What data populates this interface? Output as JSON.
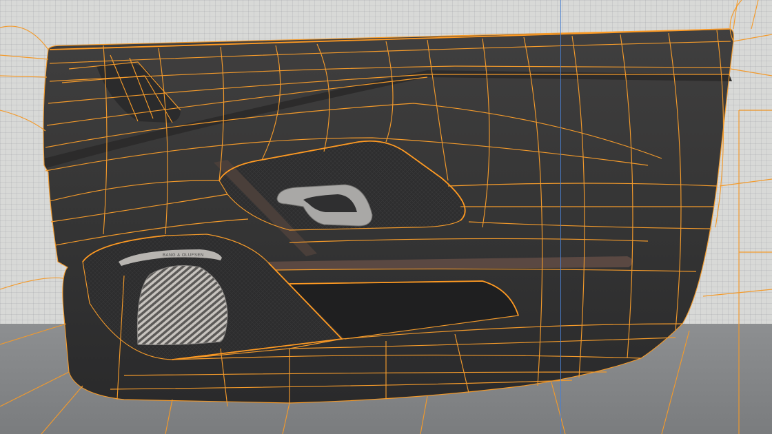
{
  "scene": {
    "object": "car-door-interior-panel",
    "overlay": "wireframe-topology",
    "colors": {
      "wireframe": "#f39a2b",
      "panel": "#3a3a3b",
      "panel_dark": "#262627",
      "background": "#d8d9d7",
      "floor": "#84868a",
      "axis": "#4a7fd0",
      "speaker": "#b5b1ac",
      "handle": "#a8a7a5"
    }
  },
  "speaker_grille": {
    "brand_text": "BANG & OLUFSEN"
  }
}
